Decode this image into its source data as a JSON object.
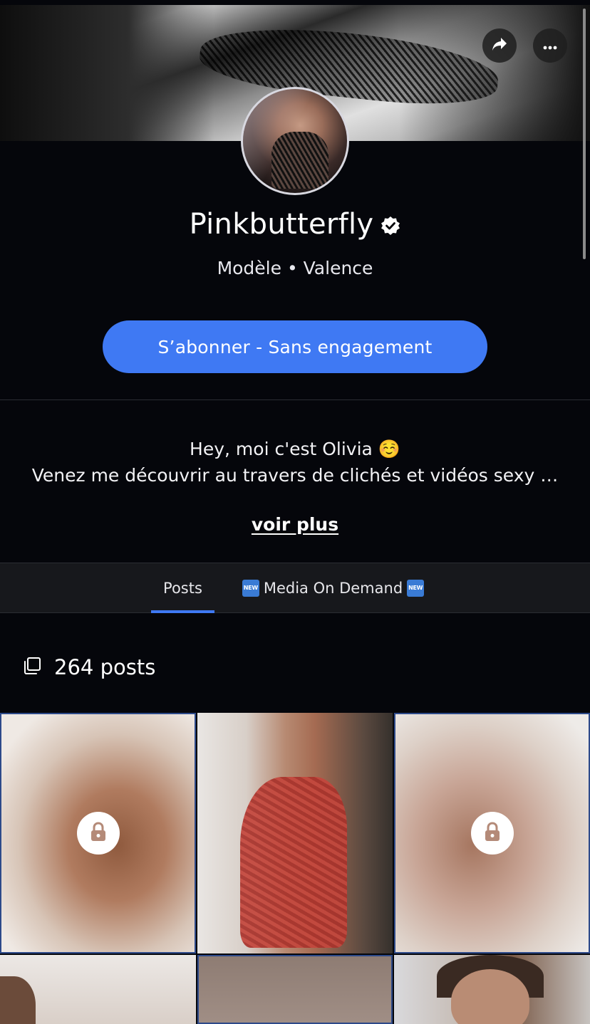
{
  "profile": {
    "name": "Pinkbutterfly",
    "subtitle": "Modèle • Valence",
    "verified": true
  },
  "actions": {
    "subscribe_label": "S’abonner - Sans engagement",
    "share_icon": "share-icon",
    "more_icon": "more-options-icon"
  },
  "bio": {
    "line1": "Hey, moi c'est Olivia ☺️",
    "line2": "Venez me découvrir au travers de clichés et vidéos sexy …",
    "more_label": "voir plus"
  },
  "tabs": [
    {
      "label": "Posts",
      "active": true
    },
    {
      "label": "Media On Demand",
      "badge": "NEW",
      "active": false
    }
  ],
  "posts": {
    "count_label": "264 posts",
    "tiles": [
      {
        "locked": true
      },
      {
        "locked": false
      },
      {
        "locked": true
      },
      {
        "locked": false
      },
      {
        "locked": false
      },
      {
        "locked": false
      }
    ]
  },
  "colors": {
    "background": "#05060b",
    "accent": "#3f79f3",
    "tab_bar": "#17181c"
  }
}
